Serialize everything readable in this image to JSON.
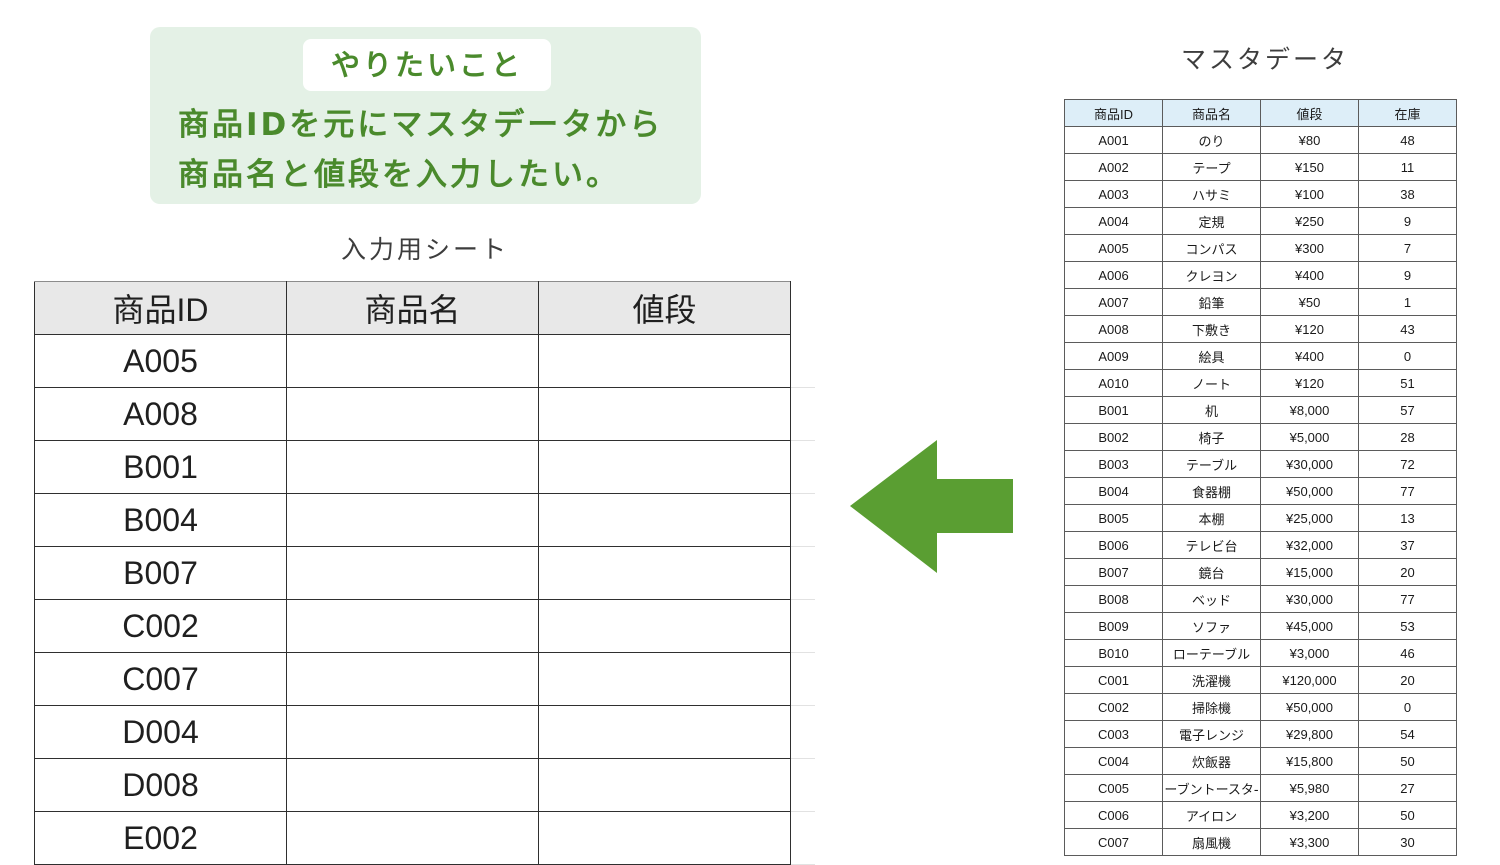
{
  "goal": {
    "tag": "やりたいこと",
    "line1": "商品IDを元にマスタデータから",
    "line2": "商品名と値段を入力したい。"
  },
  "input_sheet": {
    "caption": "入力用シート",
    "headers": [
      "商品ID",
      "商品名",
      "値段"
    ],
    "ids": [
      "A005",
      "A008",
      "B001",
      "B004",
      "B007",
      "C002",
      "C007",
      "D004",
      "D008",
      "E002"
    ]
  },
  "colors": {
    "accent_green": "#4a8a2c",
    "arrow_green": "#5a9e32",
    "goal_bg": "#e4f1e6",
    "master_header_bg": "#ddeef8"
  },
  "master": {
    "caption": "マスタデータ",
    "headers": [
      "商品ID",
      "商品名",
      "値段",
      "在庫"
    ],
    "rows": [
      [
        "A001",
        "のり",
        "¥80",
        "48"
      ],
      [
        "A002",
        "テープ",
        "¥150",
        "11"
      ],
      [
        "A003",
        "ハサミ",
        "¥100",
        "38"
      ],
      [
        "A004",
        "定規",
        "¥250",
        "9"
      ],
      [
        "A005",
        "コンパス",
        "¥300",
        "7"
      ],
      [
        "A006",
        "クレヨン",
        "¥400",
        "9"
      ],
      [
        "A007",
        "鉛筆",
        "¥50",
        "1"
      ],
      [
        "A008",
        "下敷き",
        "¥120",
        "43"
      ],
      [
        "A009",
        "絵具",
        "¥400",
        "0"
      ],
      [
        "A010",
        "ノート",
        "¥120",
        "51"
      ],
      [
        "B001",
        "机",
        "¥8,000",
        "57"
      ],
      [
        "B002",
        "椅子",
        "¥5,000",
        "28"
      ],
      [
        "B003",
        "テーブル",
        "¥30,000",
        "72"
      ],
      [
        "B004",
        "食器棚",
        "¥50,000",
        "77"
      ],
      [
        "B005",
        "本棚",
        "¥25,000",
        "13"
      ],
      [
        "B006",
        "テレビ台",
        "¥32,000",
        "37"
      ],
      [
        "B007",
        "鏡台",
        "¥15,000",
        "20"
      ],
      [
        "B008",
        "ベッド",
        "¥30,000",
        "77"
      ],
      [
        "B009",
        "ソファ",
        "¥45,000",
        "53"
      ],
      [
        "B010",
        "ローテーブル",
        "¥3,000",
        "46"
      ],
      [
        "C001",
        "洗濯機",
        "¥120,000",
        "20"
      ],
      [
        "C002",
        "掃除機",
        "¥50,000",
        "0"
      ],
      [
        "C003",
        "電子レンジ",
        "¥29,800",
        "54"
      ],
      [
        "C004",
        "炊飯器",
        "¥15,800",
        "50"
      ],
      [
        "C005",
        "ーブントースタ-",
        "¥5,980",
        "27"
      ],
      [
        "C006",
        "アイロン",
        "¥3,200",
        "50"
      ],
      [
        "C007",
        "扇風機",
        "¥3,300",
        "30"
      ]
    ]
  }
}
